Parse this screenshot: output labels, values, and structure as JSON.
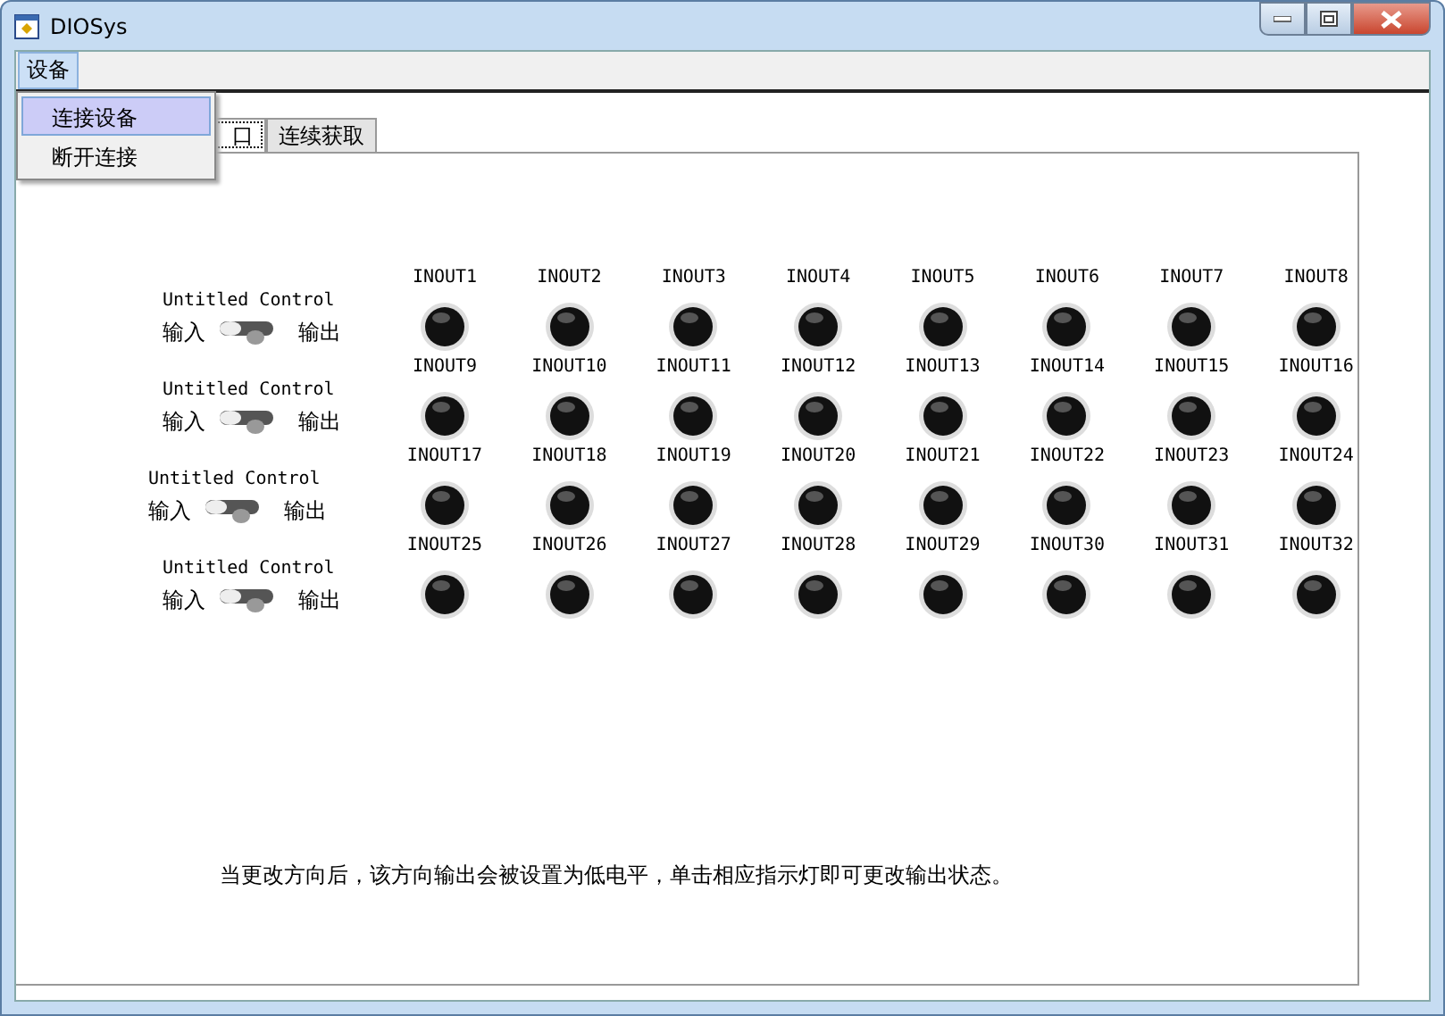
{
  "window": {
    "title": "DIOSys"
  },
  "menu": [
    {
      "label": "设备",
      "selected": true
    }
  ],
  "dropdown": [
    {
      "label": "连接设备",
      "selected": true
    },
    {
      "label": "断开连接",
      "selected": false
    }
  ],
  "tabs": [
    {
      "label": "口",
      "selected": true
    },
    {
      "label": "连续获取",
      "selected": false
    }
  ],
  "groups": [
    {
      "control": {
        "label": "Untitled Control",
        "left": "输入",
        "right": "输出",
        "on": false
      },
      "lights": [
        {
          "label": "INOUT1",
          "on": false
        },
        {
          "label": "INOUT2",
          "on": false
        },
        {
          "label": "INOUT3",
          "on": false
        },
        {
          "label": "INOUT4",
          "on": false
        },
        {
          "label": "INOUT5",
          "on": false
        },
        {
          "label": "INOUT6",
          "on": false
        },
        {
          "label": "INOUT7",
          "on": false
        },
        {
          "label": "INOUT8",
          "on": false
        }
      ]
    },
    {
      "control": {
        "label": "Untitled Control",
        "left": "输入",
        "right": "输出",
        "on": false
      },
      "lights": [
        {
          "label": "INOUT9",
          "on": false
        },
        {
          "label": "INOUT10",
          "on": false
        },
        {
          "label": "INOUT11",
          "on": false
        },
        {
          "label": "INOUT12",
          "on": false
        },
        {
          "label": "INOUT13",
          "on": false
        },
        {
          "label": "INOUT14",
          "on": false
        },
        {
          "label": "INOUT15",
          "on": false
        },
        {
          "label": "INOUT16",
          "on": false
        }
      ]
    },
    {
      "control": {
        "label": "Untitled Control",
        "left": "输入",
        "right": "输出",
        "on": false
      },
      "lights": [
        {
          "label": "INOUT17",
          "on": false
        },
        {
          "label": "INOUT18",
          "on": false
        },
        {
          "label": "INOUT19",
          "on": false
        },
        {
          "label": "INOUT20",
          "on": false
        },
        {
          "label": "INOUT21",
          "on": false
        },
        {
          "label": "INOUT22",
          "on": false
        },
        {
          "label": "INOUT23",
          "on": false
        },
        {
          "label": "INOUT24",
          "on": false
        }
      ]
    },
    {
      "control": {
        "label": "Untitled Control",
        "left": "输入",
        "right": "输出",
        "on": false
      },
      "lights": [
        {
          "label": "INOUT25",
          "on": false
        },
        {
          "label": "INOUT26",
          "on": false
        },
        {
          "label": "INOUT27",
          "on": false
        },
        {
          "label": "INOUT28",
          "on": false
        },
        {
          "label": "INOUT29",
          "on": false
        },
        {
          "label": "INOUT30",
          "on": false
        },
        {
          "label": "INOUT31",
          "on": false
        },
        {
          "label": "INOUT32",
          "on": false
        }
      ]
    }
  ],
  "note": "当更改方向后，该方向输出会被设置为低电平，单击相应指示灯即可更改输出状态。"
}
